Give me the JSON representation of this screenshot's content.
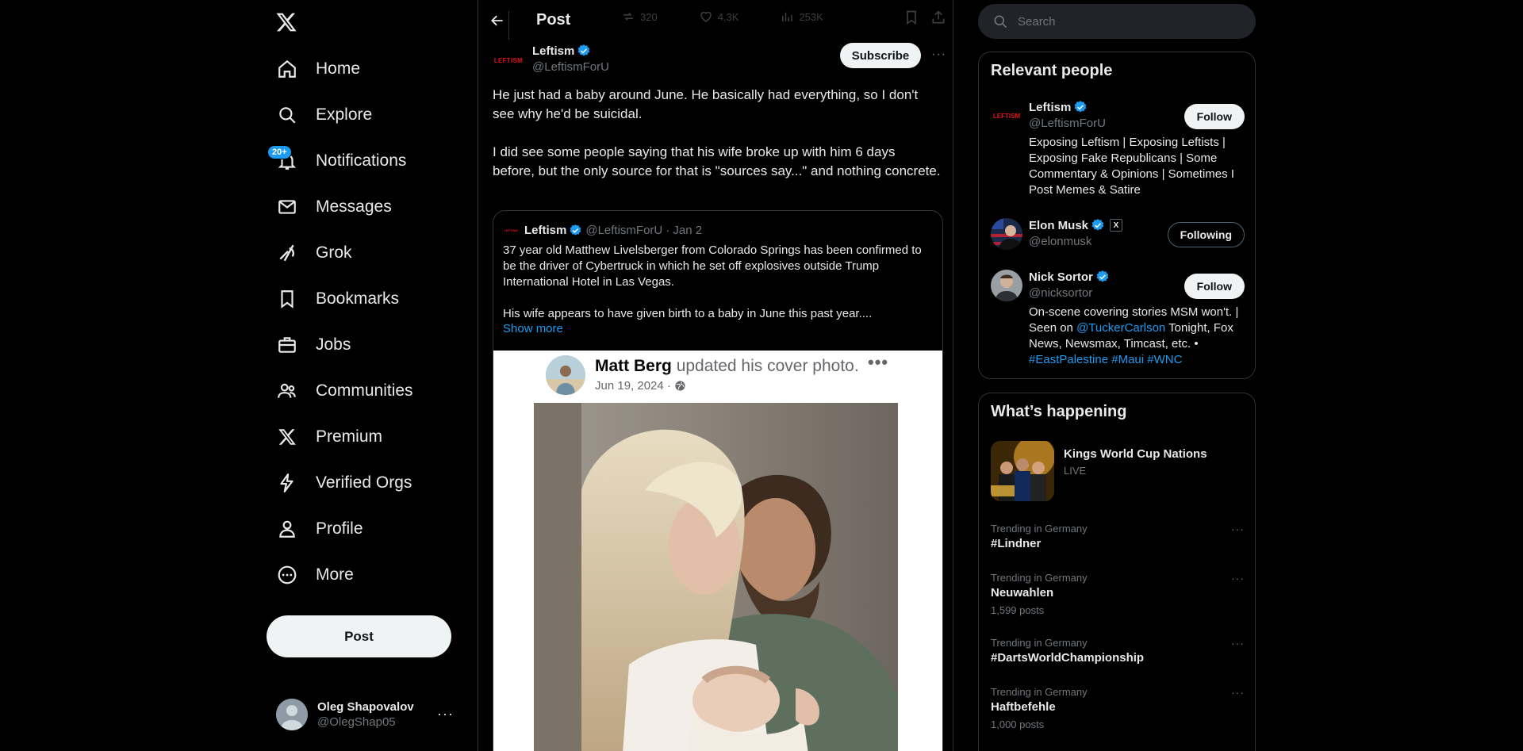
{
  "nav": {
    "items": [
      {
        "label": "Home",
        "icon": "home-icon"
      },
      {
        "label": "Explore",
        "icon": "search-icon"
      },
      {
        "label": "Notifications",
        "icon": "bell-icon"
      },
      {
        "label": "Messages",
        "icon": "envelope-icon"
      },
      {
        "label": "Grok",
        "icon": "grok-icon"
      },
      {
        "label": "Bookmarks",
        "icon": "bookmark-icon"
      },
      {
        "label": "Jobs",
        "icon": "briefcase-icon"
      },
      {
        "label": "Communities",
        "icon": "people-icon"
      },
      {
        "label": "Premium",
        "icon": "x-logo-icon"
      },
      {
        "label": "Verified Orgs",
        "icon": "lightning-icon"
      },
      {
        "label": "Profile",
        "icon": "person-icon"
      },
      {
        "label": "More",
        "icon": "more-circle-icon"
      }
    ],
    "notifications_badge": "20+",
    "post_button": "Post"
  },
  "account": {
    "name": "Oleg Shapovalov",
    "handle": "@OlegShap05",
    "more": "···"
  },
  "header": {
    "title": "Post",
    "faint_stats": {
      "reposts": "320",
      "likes": "4.3K",
      "views": "253K"
    }
  },
  "post": {
    "author_name": "Leftism",
    "author_handle": "@LeftismForU",
    "avatar_text": "LEFTISM",
    "subscribe": "Subscribe",
    "more": "···",
    "paragraphs": [
      "He just had a baby around June. He basically had everything, so I don't see why he'd be suicidal.",
      "I did see some people saying that his wife broke up with him 6 days before, but the only source for that is \"sources say...\" and nothing concrete."
    ]
  },
  "quote": {
    "author_name": "Leftism",
    "author_handle": "@LeftismForU",
    "date": "· Jan 2",
    "avatar_text": "LEFTISM",
    "paragraphs": [
      "37 year old Matthew Livelsberger from Colorado Springs has been confirmed to be the driver of Cybertruck in which he set off explosives outside Trump International Hotel in Las Vegas.",
      "His wife appears to have given birth to a baby in June this past year...."
    ],
    "show_more": "Show more",
    "embed": {
      "name": "Matt Berg",
      "action": "updated his cover photo.",
      "date": "Jun 19, 2024 ·",
      "dots": "•••"
    }
  },
  "search": {
    "placeholder": "Search"
  },
  "relevant": {
    "title": "Relevant people",
    "people": [
      {
        "name": "Leftism",
        "handle": "@LeftismForU",
        "button": "Follow",
        "avatar_text": "LEFTISM",
        "bio": "Exposing Leftism | Exposing Leftists | Exposing Fake Republicans | Some Commentary & Opinions | Sometimes I Post Memes & Satire"
      },
      {
        "name": "Elon Musk",
        "handle": "@elonmusk",
        "button": "Following",
        "affiliate_badge": "X"
      },
      {
        "name": "Nick Sortor",
        "handle": "@nicksortor",
        "button": "Follow",
        "bio_parts": {
          "a": "On-scene covering stories MSM won't. | Seen on ",
          "mention": "@TuckerCarlson",
          "b": " Tonight, Fox News, Newsmax, Timcast, etc. • ",
          "tags": "#EastPalestine #Maui #WNC"
        }
      }
    ]
  },
  "happening": {
    "title": "What’s happening",
    "live": {
      "name": "Kings World Cup Nations",
      "status": "LIVE"
    },
    "trends": [
      {
        "context": "Trending in Germany",
        "name": "#Lindner",
        "posts": ""
      },
      {
        "context": "Trending in Germany",
        "name": "Neuwahlen",
        "posts": "1,599 posts"
      },
      {
        "context": "Trending in Germany",
        "name": "#DartsWorldChampionship",
        "posts": ""
      },
      {
        "context": "Trending in Germany",
        "name": "Haftbefehle",
        "posts": "1,000 posts"
      }
    ],
    "more": "···"
  },
  "colors": {
    "accent": "#1d9bf0",
    "bg": "#000000",
    "border": "#2f3336",
    "muted": "#71767b",
    "brand_red": "#e0141e"
  }
}
